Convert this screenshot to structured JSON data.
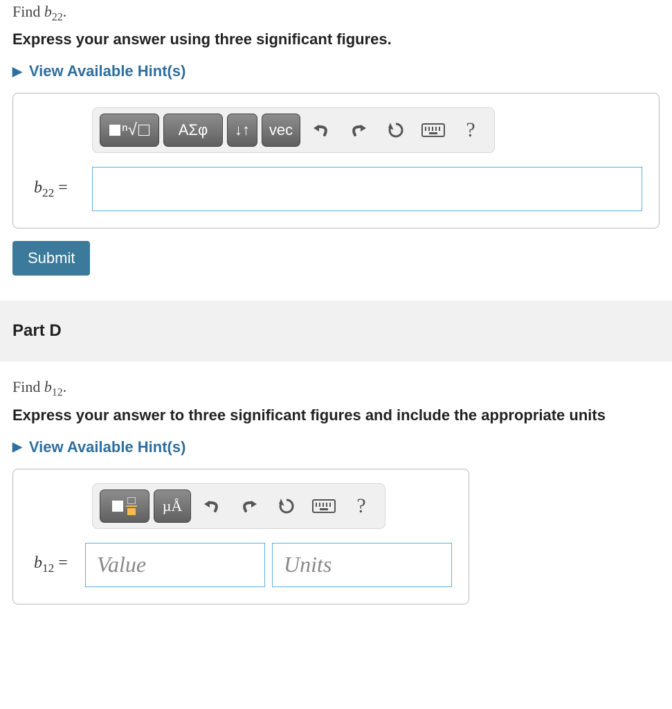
{
  "partC": {
    "prompt_prefix": "Find ",
    "var_letter": "b",
    "var_sub": "22",
    "prompt_suffix": ".",
    "instruction": "Express your answer using three significant figures.",
    "hints_label": "View Available Hint(s)",
    "toolbar": {
      "templates_name": "templates-button",
      "greek_label": "ΑΣφ",
      "subsup_label": "↓↑",
      "vec_label": "vec",
      "undo_name": "undo",
      "redo_name": "redo",
      "reset_name": "reset",
      "keyboard_name": "keyboard",
      "help_label": "?"
    },
    "lhs_var": "b",
    "lhs_sub": "22",
    "lhs_eq": " = ",
    "submit_label": "Submit"
  },
  "partD": {
    "header": "Part D",
    "prompt_prefix": "Find ",
    "var_letter": "b",
    "var_sub": "12",
    "prompt_suffix": ".",
    "instruction": "Express your answer to three significant figures and include the appropriate units",
    "hints_label": "View Available Hint(s)",
    "toolbar": {
      "templates_name": "templates-button",
      "units_label": "µÅ",
      "undo_name": "undo",
      "redo_name": "redo",
      "reset_name": "reset",
      "keyboard_name": "keyboard",
      "help_label": "?"
    },
    "lhs_var": "b",
    "lhs_sub": "12",
    "lhs_eq": " = ",
    "value_placeholder": "Value",
    "units_placeholder": "Units"
  }
}
